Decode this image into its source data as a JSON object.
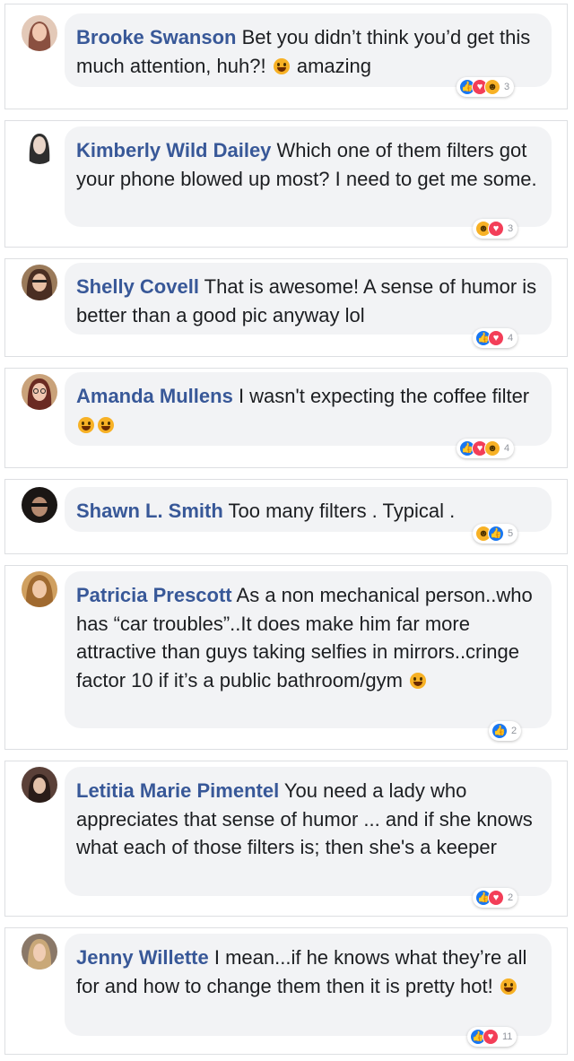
{
  "comments": [
    {
      "name": "Brooke Swanson",
      "text_1": "Bet you didn’t think you’d get this much attention, huh?!",
      "text_2": "amazing",
      "reactions": [
        "like-icon",
        "love-icon",
        "haha-icon"
      ],
      "count": "3",
      "avatar_color": "#b5705a"
    },
    {
      "name": "Kimberly Wild Dailey",
      "text_1": "Which one of them filters got your phone blowed up most? I need to get me some.",
      "reactions": [
        "haha-icon",
        "love-icon"
      ],
      "count": "3",
      "avatar_color": "#3a3a3a"
    },
    {
      "name": "Shelly Covell",
      "text_1": "That is awesome! A sense of humor is better than a good pic anyway lol",
      "reactions": [
        "like-icon",
        "love-icon"
      ],
      "count": "4",
      "avatar_color": "#6a4a3a"
    },
    {
      "name": "Amanda Mullens",
      "text_1": "I wasn't expecting the coffee filter",
      "reactions": [
        "like-icon",
        "love-icon",
        "haha-icon"
      ],
      "count": "4",
      "avatar_color": "#8a4a4a"
    },
    {
      "name": "Shawn L. Smith",
      "text_1": "Too many filters . Typical .",
      "reactions": [
        "haha-icon",
        "like-icon"
      ],
      "count": "5",
      "avatar_color": "#2a2220"
    },
    {
      "name": "Patricia Prescott",
      "text_1": "As a non mechanical person..who has “car troubles”..It does make him far more attractive than guys taking selfies in mirrors..cringe factor 10 if it’s a public bathroom/gym",
      "reactions": [
        "like-icon"
      ],
      "count": "2",
      "avatar_color": "#c08a4a"
    },
    {
      "name": "Letitia Marie Pimentel",
      "text_1": "You need a lady who appreciates that sense of humor ... and if she knows what each of those filters is; then she's a keeper",
      "reactions": [
        "like-icon",
        "love-icon"
      ],
      "count": "2",
      "avatar_color": "#4a3a34"
    },
    {
      "name": "Jenny Willette",
      "text_1": "I mean...if he knows what they’re all for and how to change them then it is pretty hot!",
      "reactions": [
        "like-icon",
        "love-icon"
      ],
      "count": "11",
      "avatar_color": "#7a6a5a"
    }
  ],
  "colors": {
    "name": "#385898",
    "bubble": "#f2f3f5",
    "like": "#1877f2",
    "love": "#f33e58",
    "haha": "#f7b125"
  }
}
